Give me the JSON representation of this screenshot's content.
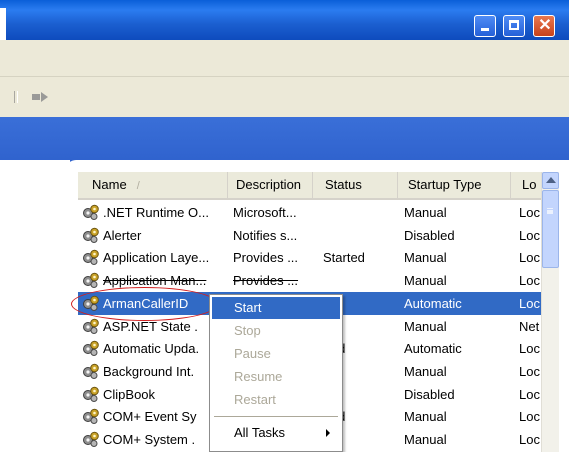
{
  "window": {
    "close_glyph": "✕"
  },
  "columns": {
    "name": "Name",
    "description": "Description",
    "status": "Status",
    "startup": "Startup Type",
    "logon": "Lo"
  },
  "rows": [
    {
      "name": ".NET Runtime O...",
      "description": "Microsoft...",
      "status": "",
      "startup": "Manual",
      "logon": "Loc"
    },
    {
      "name": "Alerter",
      "description": "Notifies s...",
      "status": "",
      "startup": "Disabled",
      "logon": "Loc"
    },
    {
      "name": "Application Laye...",
      "description": "Provides ...",
      "status": "Started",
      "startup": "Manual",
      "logon": "Loc"
    },
    {
      "name": "Application Man...",
      "description": "Provides ...",
      "status": "",
      "startup": "Manual",
      "logon": "Loc"
    },
    {
      "name": "ArmanCallerID",
      "description": "",
      "status": "",
      "startup": "Automatic",
      "logon": "Loc"
    },
    {
      "name": "ASP.NET State .",
      "description": "",
      "status": "",
      "startup": "Manual",
      "logon": "Net"
    },
    {
      "name": "Automatic Upda.",
      "description": "",
      "status": "rted",
      "startup": "Automatic",
      "logon": "Loc"
    },
    {
      "name": "Background Int.",
      "description": "",
      "status": "",
      "startup": "Manual",
      "logon": "Loc"
    },
    {
      "name": "ClipBook",
      "description": "",
      "status": "",
      "startup": "Disabled",
      "logon": "Loc"
    },
    {
      "name": "COM+ Event Sy",
      "description": "",
      "status": "rted",
      "startup": "Manual",
      "logon": "Loc"
    },
    {
      "name": "COM+ System .",
      "description": "",
      "status": "",
      "startup": "Manual",
      "logon": "Loc"
    }
  ],
  "context_menu": {
    "start": "Start",
    "stop": "Stop",
    "pause": "Pause",
    "resume": "Resume",
    "restart": "Restart",
    "all_tasks": "All Tasks"
  },
  "icons": {
    "service_icon": "gears-icon",
    "scroll_up": "chevron-up-icon",
    "submenu": "chevron-right-icon"
  },
  "colors": {
    "title_bar": "#0a5fd8",
    "selection": "#316ac5",
    "annotation_oval": "#d21e1e",
    "close_button": "#c8421b"
  }
}
